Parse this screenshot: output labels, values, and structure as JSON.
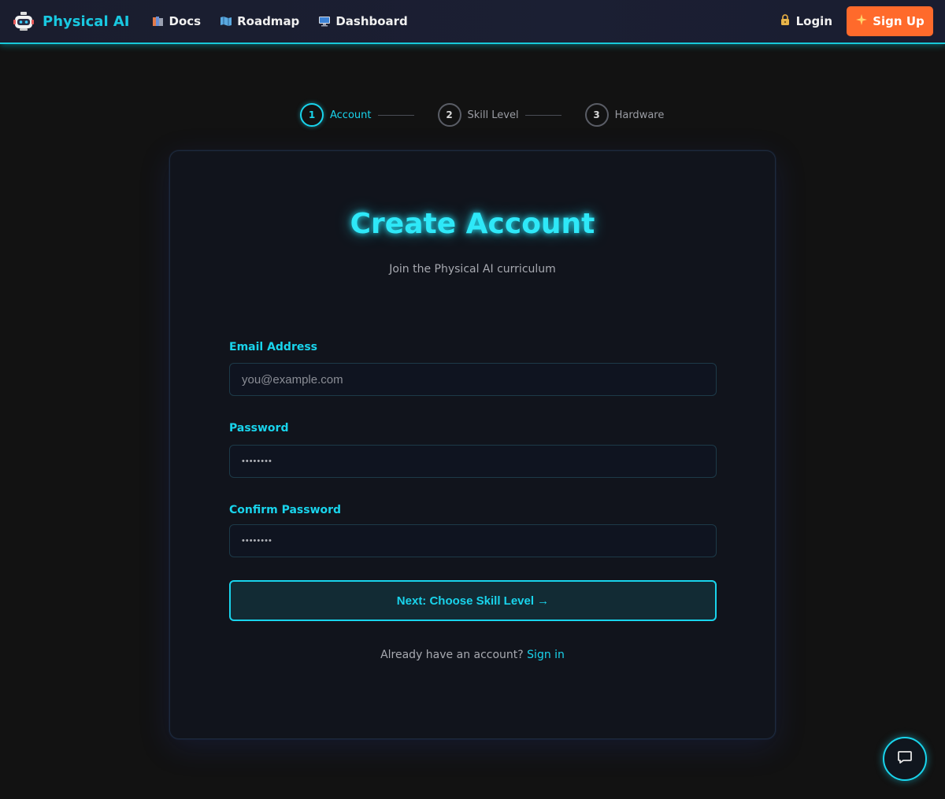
{
  "navbar": {
    "brand": "Physical AI",
    "links": [
      {
        "label": "Docs",
        "icon": "books-icon"
      },
      {
        "label": "Roadmap",
        "icon": "map-icon"
      },
      {
        "label": "Dashboard",
        "icon": "computer-icon"
      }
    ],
    "login_label": "Login",
    "signup_label": "Sign Up"
  },
  "stepper": {
    "steps": [
      {
        "number": "1",
        "label": "Account",
        "active": true
      },
      {
        "number": "2",
        "label": "Skill Level",
        "active": false
      },
      {
        "number": "3",
        "label": "Hardware",
        "active": false
      }
    ]
  },
  "form": {
    "title": "Create Account",
    "subtitle": "Join the Physical AI curriculum",
    "email_label": "Email Address",
    "email_placeholder": "you@example.com",
    "password_label": "Password",
    "password_value": "••••••••",
    "confirm_label": "Confirm Password",
    "confirm_value": "••••••••",
    "next_label": "Next: Choose Skill Level →",
    "signin_prompt": "Already have an account?",
    "signin_link": "Sign in"
  },
  "colors": {
    "accent": "#19d4ec",
    "signup": "#ff6a2b",
    "background": "#121212"
  }
}
